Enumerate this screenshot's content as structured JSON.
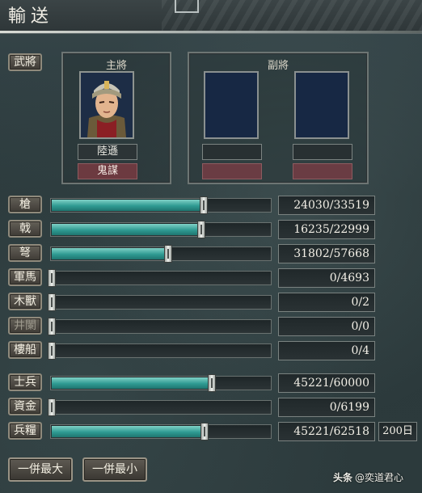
{
  "window": {
    "title": "輸送"
  },
  "officers": {
    "tab_label": "武將",
    "main_header": "主將",
    "main_name": "陸遜",
    "main_skill": "鬼謀",
    "vice_header": "副將"
  },
  "resources": [
    {
      "label": "槍",
      "current": 24030,
      "max": 33519,
      "value_text": "24030/33519",
      "fraction": 0.717
    },
    {
      "label": "戟",
      "current": 16235,
      "max": 22999,
      "value_text": "16235/22999",
      "fraction": 0.706
    },
    {
      "label": "弩",
      "current": 31802,
      "max": 57668,
      "value_text": "31802/57668",
      "fraction": 0.551
    },
    {
      "label": "軍馬",
      "current": 0,
      "max": 4693,
      "value_text": "0/4693",
      "fraction": 0
    },
    {
      "label": "木獸",
      "current": 0,
      "max": 2,
      "value_text": "0/2",
      "fraction": 0
    },
    {
      "label": "井闌",
      "current": 0,
      "max": 0,
      "value_text": "0/0",
      "fraction": 0,
      "disabled": true
    },
    {
      "label": "樓船",
      "current": 0,
      "max": 4,
      "value_text": "0/4",
      "fraction": 0
    }
  ],
  "supplies": [
    {
      "label": "士兵",
      "current": 45221,
      "max": 60000,
      "value_text": "45221/60000",
      "fraction": 0.754
    },
    {
      "label": "資金",
      "current": 0,
      "max": 6199,
      "value_text": "0/6199",
      "fraction": 0
    },
    {
      "label": "兵糧",
      "current": 45221,
      "max": 62518,
      "value_text": "45221/62518",
      "fraction": 0.723
    }
  ],
  "days": "200日",
  "buttons": {
    "max": "一併最大",
    "min": "一併最小"
  },
  "watermark": {
    "brand": "头条",
    "handle": "@奕道君心"
  },
  "colors": {
    "bar_fill": "#2f9a92",
    "skill_bg": "#6c3a40",
    "portrait_bg": "#172844"
  }
}
